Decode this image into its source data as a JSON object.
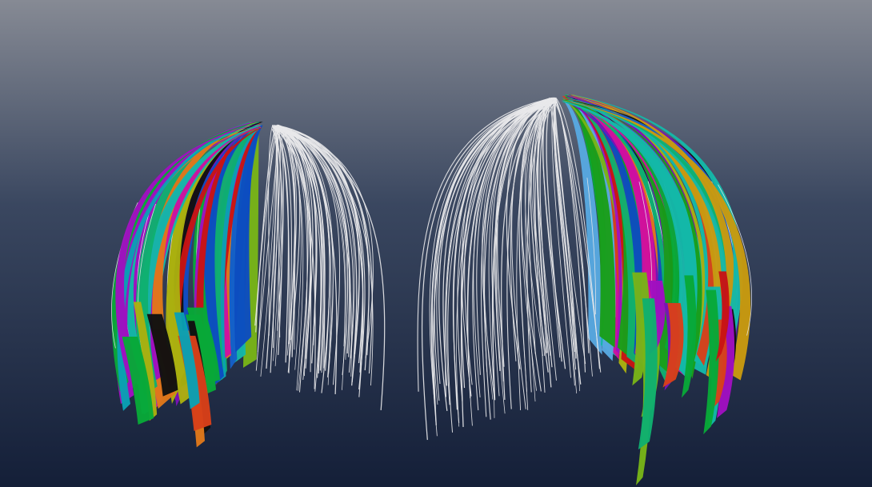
{
  "scene": {
    "background": {
      "top_color": "#868a94",
      "mid_color": "#3a4760",
      "bottom_color": "#141f38"
    },
    "strand_color": "#e8e8ea",
    "patch_palette": [
      "#1a9e1a",
      "#08a838",
      "#10b070",
      "#14b8a8",
      "#0aa0b4",
      "#0c4cc0",
      "#1560c8",
      "#7a12b8",
      "#a010c0",
      "#d010a0",
      "#c81414",
      "#d8401a",
      "#e0781a",
      "#c89a10",
      "#aab010",
      "#78b418",
      "#58a8e0",
      "#111111"
    ],
    "hair_models": [
      {
        "name": "left-hair-model",
        "colored_side": "left",
        "strand_density": 70
      },
      {
        "name": "right-hair-model",
        "colored_side": "right",
        "strand_density": 80
      }
    ]
  }
}
